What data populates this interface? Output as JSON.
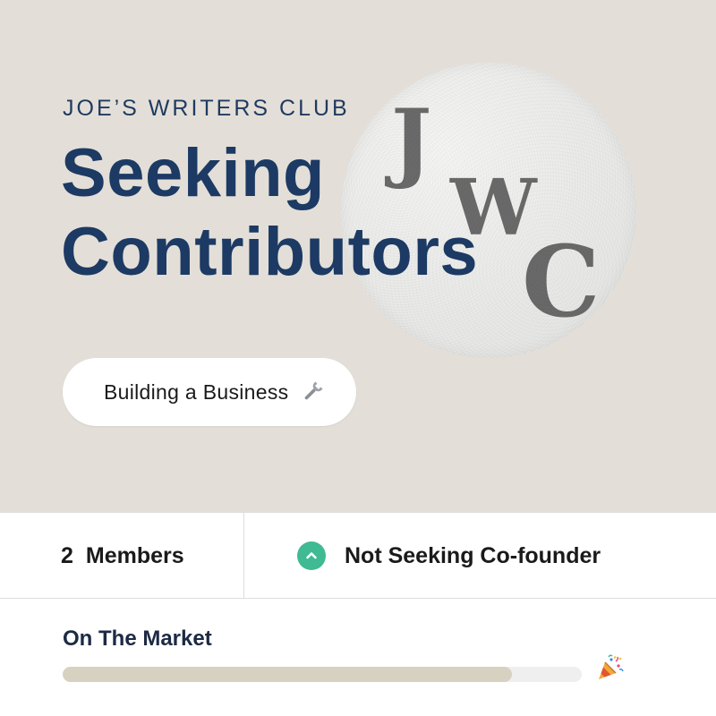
{
  "header": {
    "club_name": "JOE’S WRITERS CLUB",
    "headline_line1": "Seeking",
    "headline_line2": "Contributors",
    "logo": {
      "letters": [
        "J",
        "W",
        "C"
      ],
      "icon": "jwc-monogram-logo"
    }
  },
  "category": {
    "label": "Building a Business",
    "icon": "wrench-icon"
  },
  "stats": {
    "members_count": "2",
    "members_label": "Members",
    "cofounder_status": "Not Seeking Co-founder",
    "cofounder_icon": "chevron-up-icon",
    "cofounder_icon_color": "#3fba93"
  },
  "market": {
    "label": "On The Market",
    "progress_fraction": 0.865,
    "icon": "party-popper-icon"
  },
  "colors": {
    "hero_background": "#e3dfd8",
    "headline": "#1c3a63",
    "progress_fill": "#d7d1c2",
    "progress_track": "#efefef"
  }
}
